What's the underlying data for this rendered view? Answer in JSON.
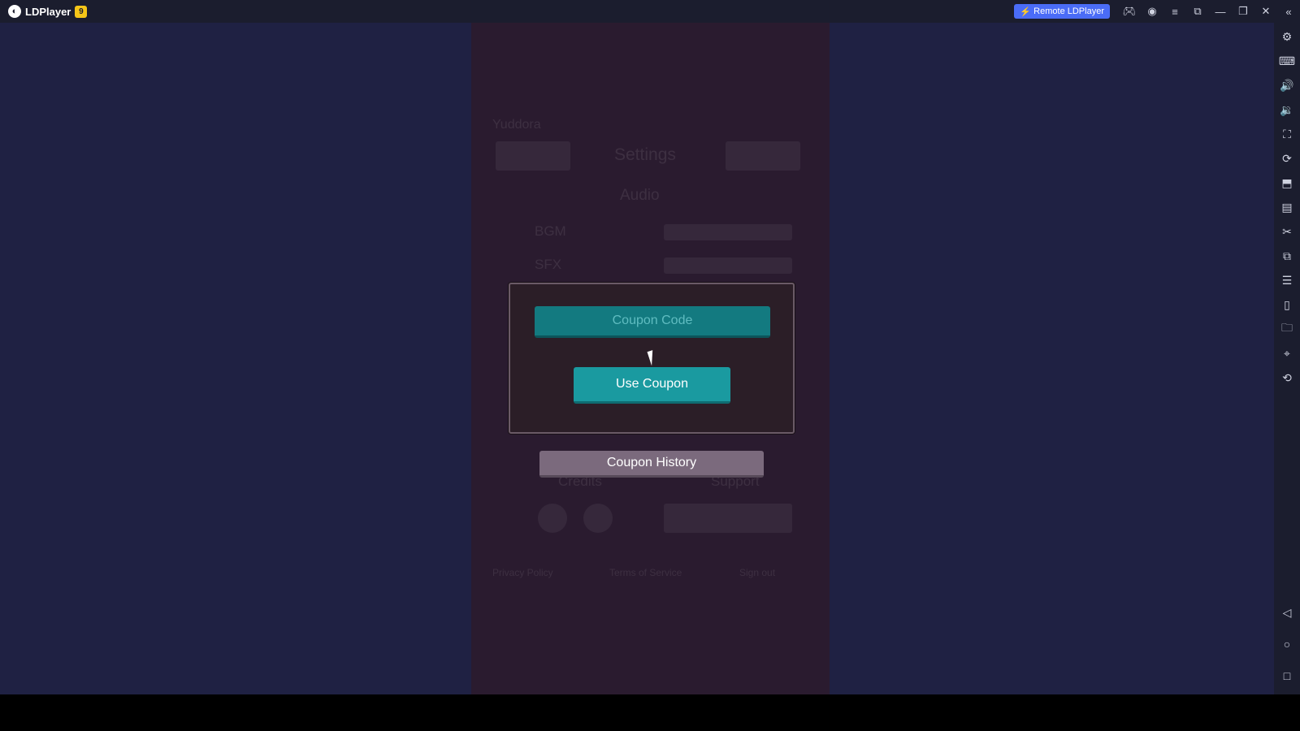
{
  "window": {
    "app_name": "LDPlayer",
    "app_badge": "9",
    "remote_button": "Remote LDPlayer",
    "title_icons": [
      "gamepad-icon",
      "account-icon",
      "menu-icon",
      "restore-icon",
      "minimize-icon",
      "maximize-icon",
      "close-icon",
      "collapse-sidebar-icon"
    ]
  },
  "sidebar": {
    "top_icons": [
      {
        "name": "settings-icon",
        "glyph": "⚙"
      },
      {
        "name": "keyboard-icon",
        "glyph": "⌨"
      },
      {
        "name": "volume-up-icon",
        "glyph": "🔊"
      },
      {
        "name": "volume-down-icon",
        "glyph": "🔉"
      },
      {
        "name": "screenshot-icon",
        "glyph": "⛶"
      },
      {
        "name": "sync-icon",
        "glyph": "⟳"
      },
      {
        "name": "install-apk-icon",
        "glyph": "⬒"
      },
      {
        "name": "apk-icon",
        "glyph": "▤"
      },
      {
        "name": "scissors-icon",
        "glyph": "✂"
      },
      {
        "name": "multi-window-icon",
        "glyph": "⧉"
      },
      {
        "name": "notes-icon",
        "glyph": "☰"
      },
      {
        "name": "shake-icon",
        "glyph": "▯"
      },
      {
        "name": "folder-icon",
        "glyph": "🗀"
      },
      {
        "name": "location-icon",
        "glyph": "⌖"
      },
      {
        "name": "rotate-icon",
        "glyph": "⟲"
      }
    ],
    "bottom_icons": [
      {
        "name": "back-icon",
        "glyph": "◁"
      },
      {
        "name": "home-icon",
        "glyph": "○"
      },
      {
        "name": "recents-icon",
        "glyph": "□"
      }
    ]
  },
  "game": {
    "background": {
      "player_name": "Yuddora",
      "title": "Settings",
      "audio_heading": "Audio",
      "bgm_label": "BGM",
      "sfx_label": "SFX",
      "credits_label": "Credits",
      "support_label": "Support",
      "footer_links": [
        "Privacy Policy",
        "Terms of Service",
        "Sign out"
      ]
    },
    "modal": {
      "coupon_placeholder": "Coupon Code",
      "use_button": "Use Coupon"
    },
    "history_button": "Coupon History"
  }
}
